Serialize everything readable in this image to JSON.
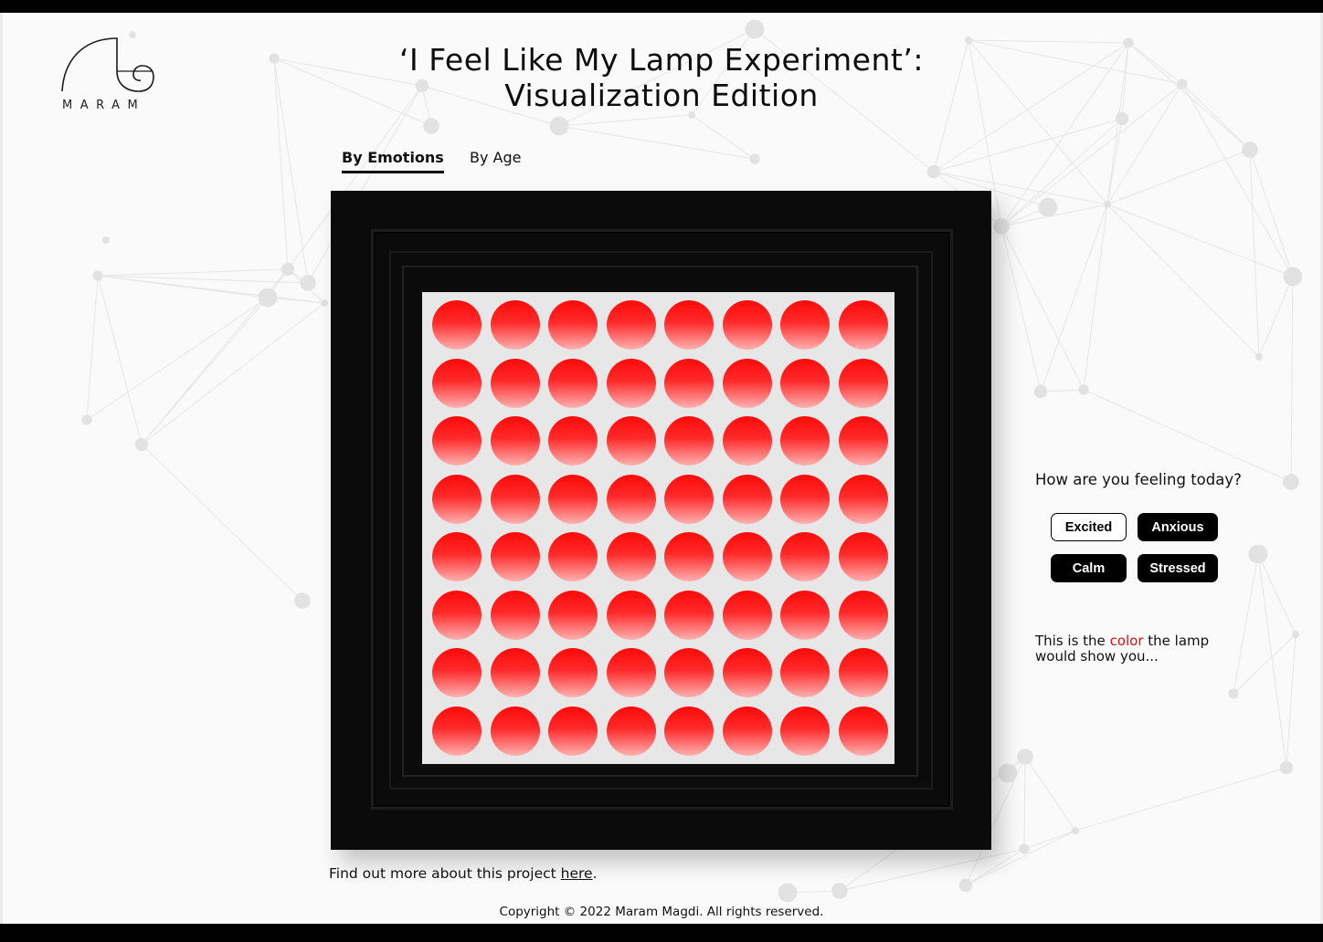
{
  "brand": {
    "logo_text": "MARAM"
  },
  "title": {
    "line1": "‘I Feel Like My Lamp Experiment’:",
    "line2": "Visualization Edition"
  },
  "tabs": [
    {
      "label": "By Emotions",
      "active": true
    },
    {
      "label": "By Age",
      "active": false
    }
  ],
  "lamp": {
    "rows": 8,
    "cols": 8,
    "color": "#ff1a1a",
    "panel_color": "#e7e7e7",
    "frame_color": "#0b0b0b"
  },
  "mood": {
    "question": "How are you feeling today?",
    "buttons": [
      {
        "label": "Excited",
        "selected": true
      },
      {
        "label": "Anxious",
        "selected": false
      },
      {
        "label": "Calm",
        "selected": false
      },
      {
        "label": "Stressed",
        "selected": false
      }
    ],
    "note_prefix": "This is the ",
    "note_accent": "color",
    "note_suffix": " the lamp would show you...",
    "accent_color": "#e01010"
  },
  "footer": {
    "more_prefix": "Find out more about this project ",
    "more_link": "here",
    "more_suffix": ".",
    "copyright": "Copyright © 2022 Maram Magdi. All rights reserved."
  }
}
